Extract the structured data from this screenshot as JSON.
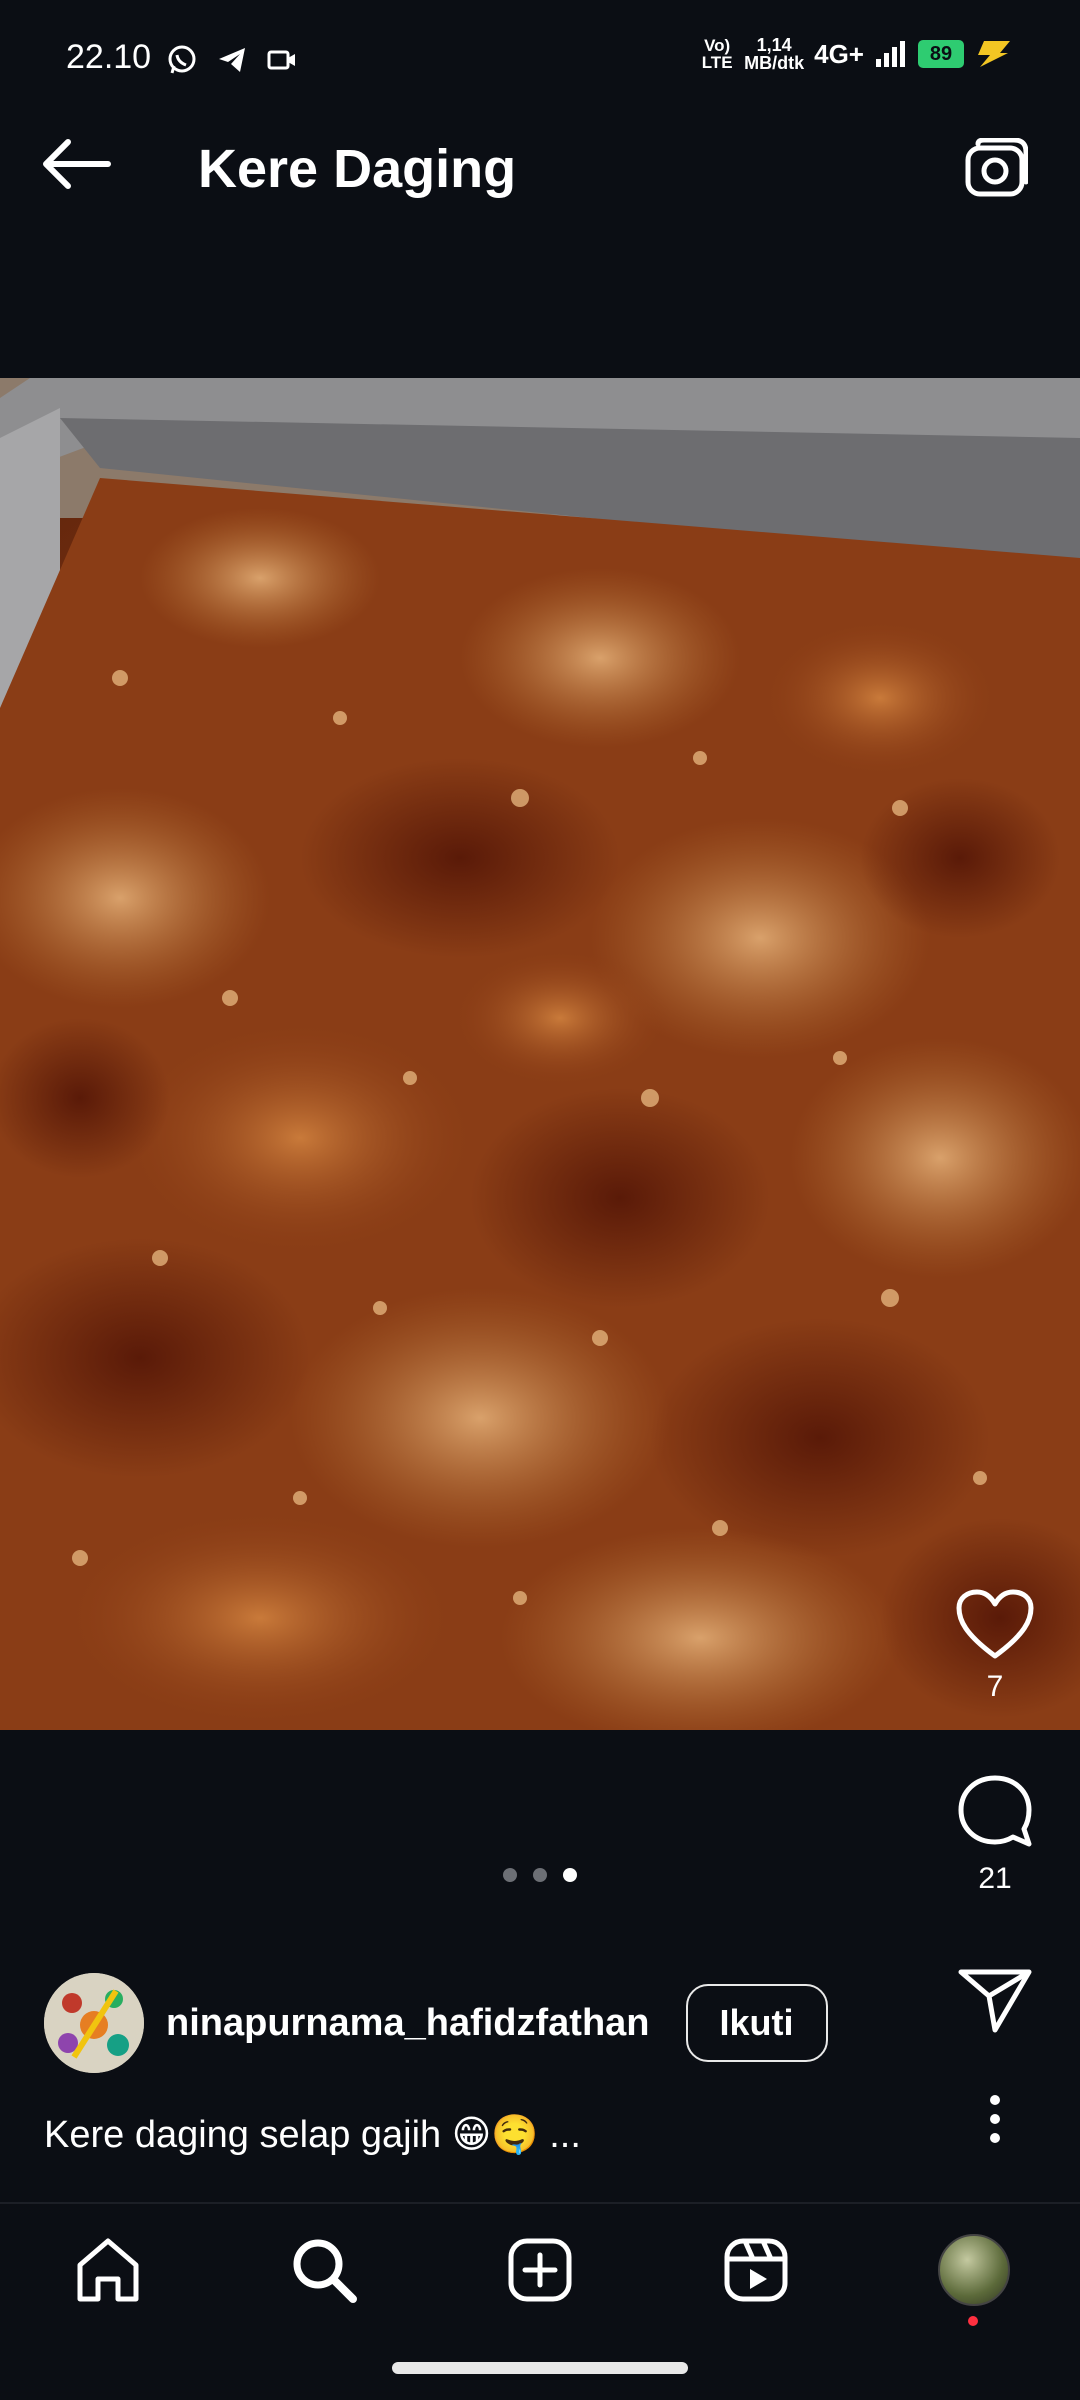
{
  "status_bar": {
    "time": "22.10",
    "volte": "Vo) LTE",
    "speed_value": "1,14",
    "speed_unit": "MB/dtk",
    "network": "4G+",
    "battery": "89"
  },
  "header": {
    "title": "Kere Daging"
  },
  "carousel": {
    "total": 3,
    "active_index": 2
  },
  "actions": {
    "likes": "7",
    "comments": "21"
  },
  "post": {
    "username": "ninapurnama_hafidzfathan",
    "follow_label": "Ikuti",
    "caption": "Kere daging selap gajih 😁🤤 ..."
  },
  "colors": {
    "background": "#0b0e14",
    "battery": "#2ecc71",
    "notification": "#ff3040"
  },
  "icons": {
    "status_left": [
      "whatsapp-icon",
      "telegram-icon",
      "video-camera-icon"
    ],
    "nav": [
      "home-icon",
      "search-icon",
      "create-icon",
      "reels-icon",
      "profile-avatar"
    ]
  }
}
